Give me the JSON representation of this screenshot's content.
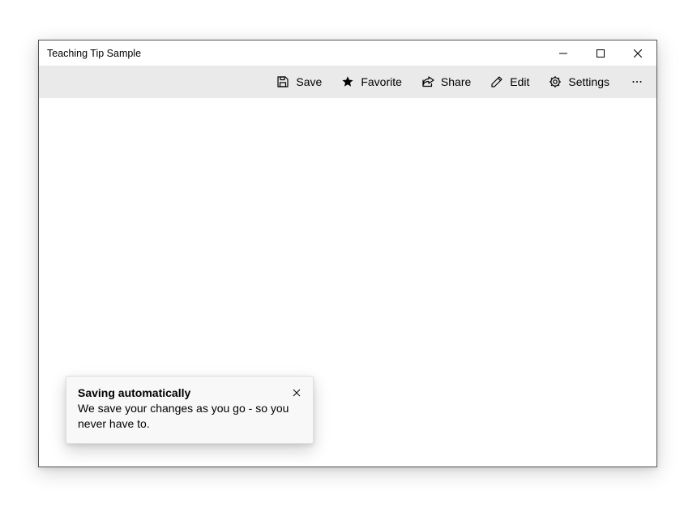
{
  "window": {
    "title": "Teaching Tip Sample"
  },
  "commandbar": {
    "save": "Save",
    "favorite": "Favorite",
    "share": "Share",
    "edit": "Edit",
    "settings": "Settings"
  },
  "teaching_tip": {
    "title": "Saving automatically",
    "body": "We save your changes as you go - so you never have to."
  }
}
